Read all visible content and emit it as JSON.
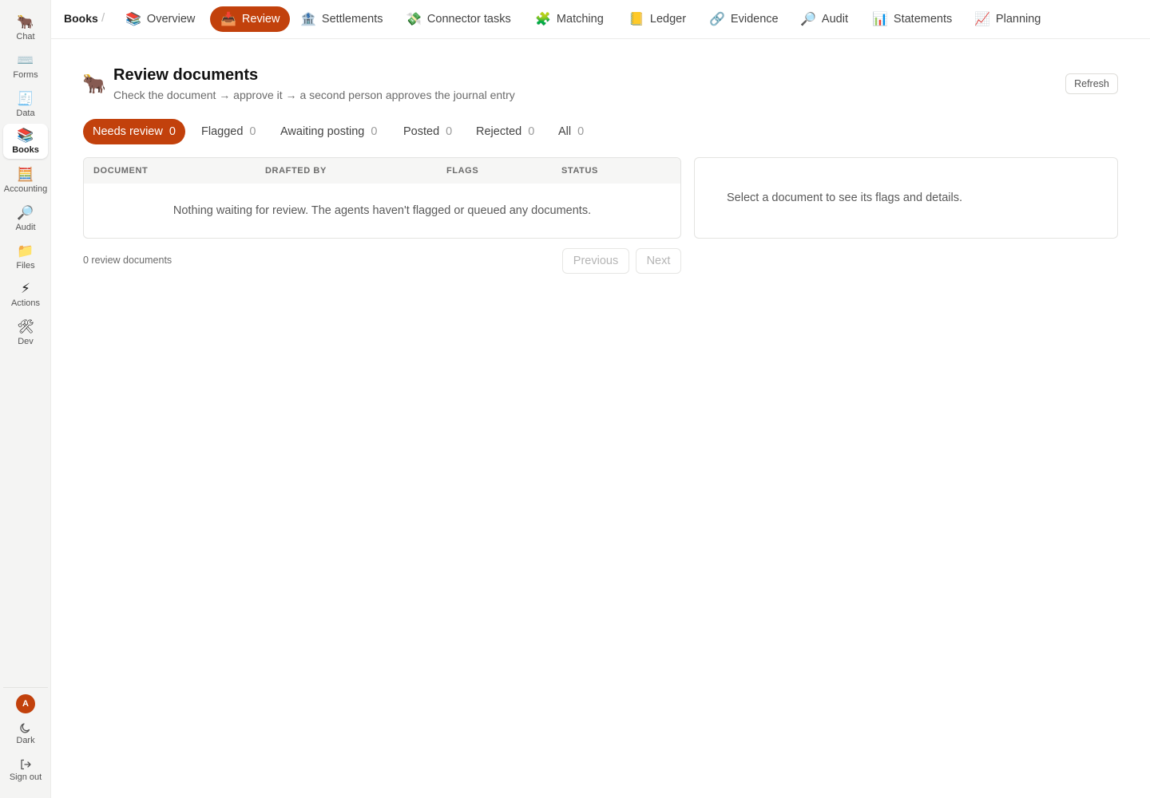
{
  "sidebar": {
    "items": [
      {
        "icon": "ox-icon",
        "glyph": "🐂",
        "label": "Chat"
      },
      {
        "icon": "keyboard-icon",
        "glyph": "⌨️",
        "label": "Forms"
      },
      {
        "icon": "receipt-icon",
        "glyph": "🧾",
        "label": "Data"
      },
      {
        "icon": "books-icon",
        "glyph": "📚",
        "label": "Books"
      },
      {
        "icon": "abacus-icon",
        "glyph": "🧮",
        "label": "Accounting"
      },
      {
        "icon": "magnifier-icon",
        "glyph": "🔎",
        "label": "Audit"
      },
      {
        "icon": "folder-icon",
        "glyph": "📁",
        "label": "Files"
      },
      {
        "icon": "lightning-icon",
        "glyph": "⚡",
        "label": "Actions"
      },
      {
        "icon": "tools-icon",
        "glyph": "🛠",
        "label": "Dev"
      }
    ],
    "active_index": 3,
    "avatar_initial": "A",
    "dark_label": "Dark",
    "signout_label": "Sign out"
  },
  "topnav": {
    "breadcrumb": "Books",
    "separator": "/",
    "tabs": [
      {
        "icon": "books-icon",
        "glyph": "📚",
        "label": "Overview"
      },
      {
        "icon": "inbox-tray-icon",
        "glyph": "📥",
        "label": "Review"
      },
      {
        "icon": "bank-icon",
        "glyph": "🏦",
        "label": "Settlements"
      },
      {
        "icon": "money-wings-icon",
        "glyph": "💸",
        "label": "Connector tasks"
      },
      {
        "icon": "puzzle-icon",
        "glyph": "🧩",
        "label": "Matching"
      },
      {
        "icon": "ledger-icon",
        "glyph": "📒",
        "label": "Ledger"
      },
      {
        "icon": "link-icon",
        "glyph": "🔗",
        "label": "Evidence"
      },
      {
        "icon": "magnifier-icon",
        "glyph": "🔎",
        "label": "Audit"
      },
      {
        "icon": "bar-chart-icon",
        "glyph": "📊",
        "label": "Statements"
      },
      {
        "icon": "trend-chart-icon",
        "glyph": "📈",
        "label": "Planning"
      }
    ],
    "active_index": 1
  },
  "header": {
    "icon_glyph": "🐂",
    "title": "Review documents",
    "subtitle": "Check the document → approve it → a second person approves the journal entry",
    "refresh_label": "Refresh"
  },
  "filters": [
    {
      "label": "Needs review",
      "count": "0"
    },
    {
      "label": "Flagged",
      "count": "0"
    },
    {
      "label": "Awaiting posting",
      "count": "0"
    },
    {
      "label": "Posted",
      "count": "0"
    },
    {
      "label": "Rejected",
      "count": "0"
    },
    {
      "label": "All",
      "count": "0"
    }
  ],
  "table": {
    "columns": [
      "DOCUMENT",
      "DRAFTED BY",
      "FLAGS",
      "STATUS"
    ],
    "empty_message": "Nothing waiting for review. The agents haven't flagged or queued any documents."
  },
  "detail": {
    "empty_message": "Select a document to see its flags and details."
  },
  "footer": {
    "count_label": "0 review documents",
    "previous_label": "Previous",
    "next_label": "Next"
  },
  "colors": {
    "accent": "#c2410c",
    "sidebar_bg": "#f4f4f3",
    "border": "#e3e3e1"
  }
}
